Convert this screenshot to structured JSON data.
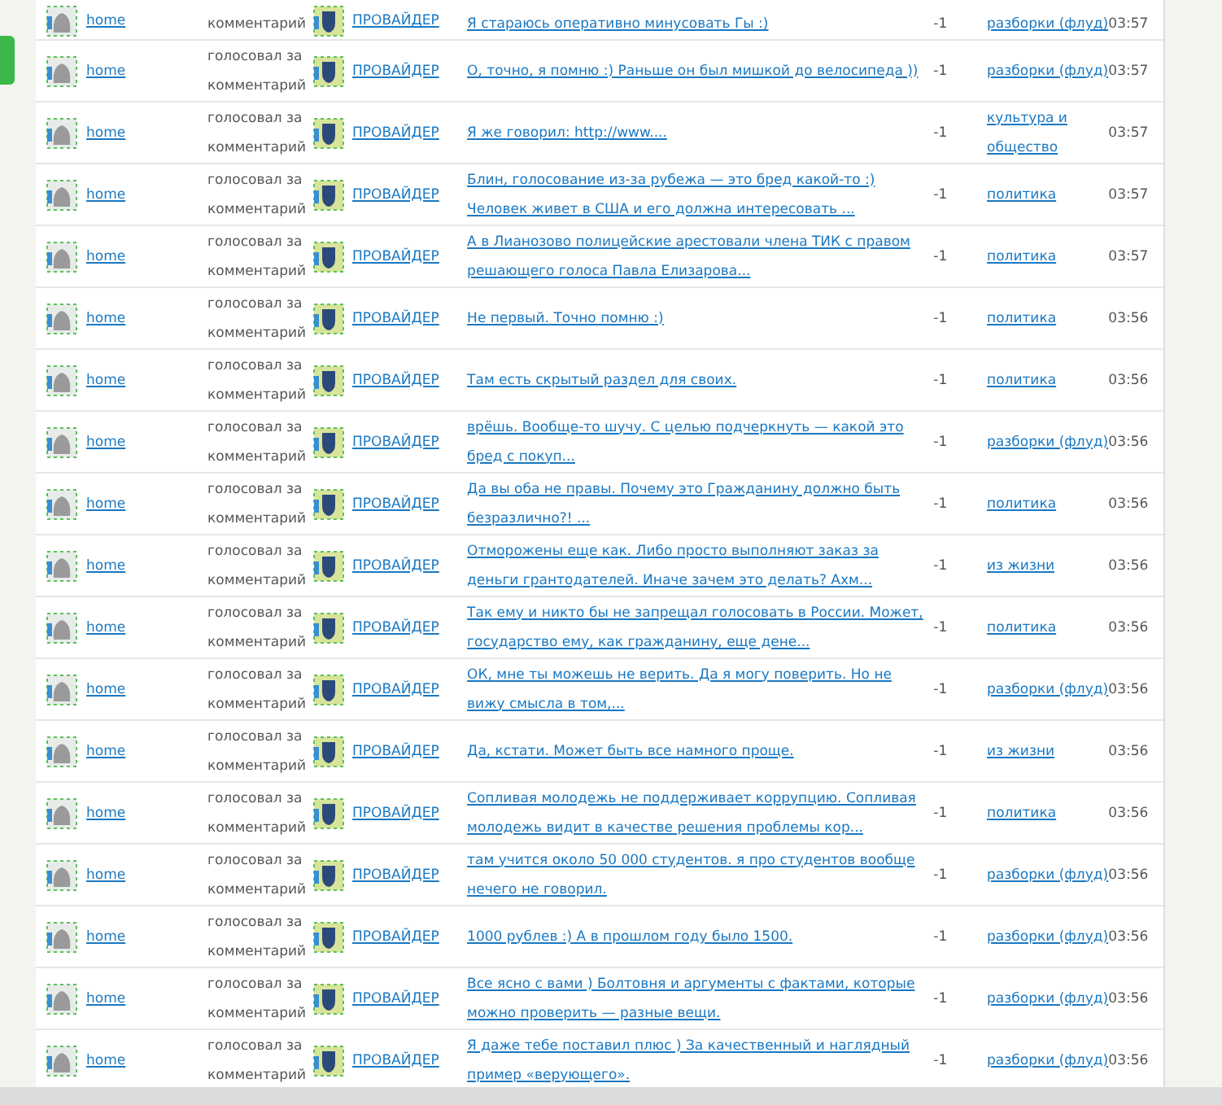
{
  "rows": [
    {
      "user": "home",
      "action": "комментарий",
      "target": "ПРОВАЙДЕР",
      "comment": "Я стараюсь оперативно минусовать Гы :)",
      "score": "-1",
      "category": "разборки (флуд)",
      "time": "03:57"
    },
    {
      "user": "home",
      "action": "голосовал за комментарий",
      "target": "ПРОВАЙДЕР",
      "comment": "О, точно, я помню :) Раньше он был мишкой до велосипеда ))",
      "score": "-1",
      "category": "разборки (флуд)",
      "time": "03:57"
    },
    {
      "user": "home",
      "action": "голосовал за комментарий",
      "target": "ПРОВАЙДЕР",
      "comment": "Я же говорил: http://www....",
      "score": "-1",
      "category": "культура и общество",
      "time": "03:57"
    },
    {
      "user": "home",
      "action": "голосовал за комментарий",
      "target": "ПРОВАЙДЕР",
      "comment": "Блин, голосование из-за рубежа — это бред какой-то :) Человек живет в США и его должна интересовать ...",
      "score": "-1",
      "category": "политика",
      "time": "03:57"
    },
    {
      "user": "home",
      "action": "голосовал за комментарий",
      "target": "ПРОВАЙДЕР",
      "comment": "А в Лианозово полицейские арестовали члена ТИК с правом решающего голоса Павла Елизарова...",
      "score": "-1",
      "category": "политика",
      "time": "03:57"
    },
    {
      "user": "home",
      "action": "голосовал за комментарий",
      "target": "ПРОВАЙДЕР",
      "comment": "Не первый. Точно помню :)",
      "score": "-1",
      "category": "политика",
      "time": "03:56"
    },
    {
      "user": "home",
      "action": "голосовал за комментарий",
      "target": "ПРОВАЙДЕР",
      "comment": "Там есть скрытый раздел для своих.",
      "score": "-1",
      "category": "политика",
      "time": "03:56"
    },
    {
      "user": "home",
      "action": "голосовал за комментарий",
      "target": "ПРОВАЙДЕР",
      "comment": "врёшь. Вообще-то шучу. С целью подчеркнуть — какой это бред с покуп...",
      "score": "-1",
      "category": "разборки (флуд)",
      "time": "03:56"
    },
    {
      "user": "home",
      "action": "голосовал за комментарий",
      "target": "ПРОВАЙДЕР",
      "comment": "Да вы оба не правы. Почему это Гражданину должно быть безразлично?! ...",
      "score": "-1",
      "category": "политика",
      "time": "03:56"
    },
    {
      "user": "home",
      "action": "голосовал за комментарий",
      "target": "ПРОВАЙДЕР",
      "comment": "Отморожены еще как. Либо просто выполняют заказ за деньги грантодателей. Иначе зачем это делать? Ахм...",
      "score": "-1",
      "category": "из жизни",
      "time": "03:56"
    },
    {
      "user": "home",
      "action": "голосовал за комментарий",
      "target": "ПРОВАЙДЕР",
      "comment": "Так ему и никто бы не запрещал голосовать в России. Может, государство ему, как гражданину, еще дене...",
      "score": "-1",
      "category": "политика",
      "time": "03:56"
    },
    {
      "user": "home",
      "action": "голосовал за комментарий",
      "target": "ПРОВАЙДЕР",
      "comment": "ОК, мне ты можешь не верить. Да я могу поверить. Но не вижу смысла в том,...",
      "score": "-1",
      "category": "разборки (флуд)",
      "time": "03:56"
    },
    {
      "user": "home",
      "action": "голосовал за комментарий",
      "target": "ПРОВАЙДЕР",
      "comment": "Да, кстати. Может быть все намного проще.",
      "score": "-1",
      "category": "из жизни",
      "time": "03:56"
    },
    {
      "user": "home",
      "action": "голосовал за комментарий",
      "target": "ПРОВАЙДЕР",
      "comment": "Сопливая молодежь не поддерживает коррупцию. Сопливая молодежь видит в качестве решения проблемы кор...",
      "score": "-1",
      "category": "политика",
      "time": "03:56"
    },
    {
      "user": "home",
      "action": "голосовал за комментарий",
      "target": "ПРОВАЙДЕР",
      "comment": "там учится около 50 000 студентов. я про студентов вообще нечего не говорил.",
      "score": "-1",
      "category": "разборки (флуд)",
      "time": "03:56"
    },
    {
      "user": "home",
      "action": "голосовал за комментарий",
      "target": "ПРОВАЙДЕР",
      "comment": "1000 рублев :) А в прошлом году было 1500.",
      "score": "-1",
      "category": "разборки (флуд)",
      "time": "03:56"
    },
    {
      "user": "home",
      "action": "голосовал за комментарий",
      "target": "ПРОВАЙДЕР",
      "comment": "Все ясно с вами ) Болтовня и аргументы с фактами, которые можно проверить — разные вещи.",
      "score": "-1",
      "category": "разборки (флуд)",
      "time": "03:56"
    },
    {
      "user": "home",
      "action": "голосовал за комментарий",
      "target": "ПРОВАЙДЕР",
      "comment": "Я даже тебе поставил плюс ) За качественный и наглядный пример «верующего».",
      "score": "-1",
      "category": "разборки (флуд)",
      "time": "03:56"
    }
  ]
}
